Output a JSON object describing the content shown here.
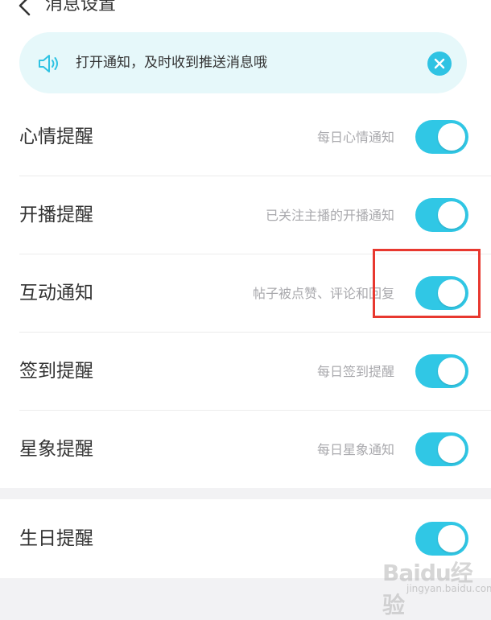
{
  "header": {
    "title": "消息设置"
  },
  "notice": {
    "text": "打开通知，及时收到推送消息哦"
  },
  "settings": [
    {
      "label": "心情提醒",
      "desc": "每日心情通知",
      "enabled": true
    },
    {
      "label": "开播提醒",
      "desc": "已关注主播的开播通知",
      "enabled": true
    },
    {
      "label": "互动通知",
      "desc": "帖子被点赞、评论和回复",
      "enabled": true
    },
    {
      "label": "签到提醒",
      "desc": "每日签到提醒",
      "enabled": true
    },
    {
      "label": "星象提醒",
      "desc": "每日星象通知",
      "enabled": true
    }
  ],
  "birthday": {
    "label": "生日提醒",
    "enabled": true
  },
  "watermark": {
    "main": "Baidu经验",
    "sub": "jingyan.baidu.com"
  },
  "colors": {
    "accent": "#30c7e5",
    "highlight": "#e8382f",
    "notice_bg": "#e6f8fa"
  },
  "icons": {
    "back": "chevron-left-icon",
    "speaker": "speaker-icon",
    "close": "close-icon"
  }
}
